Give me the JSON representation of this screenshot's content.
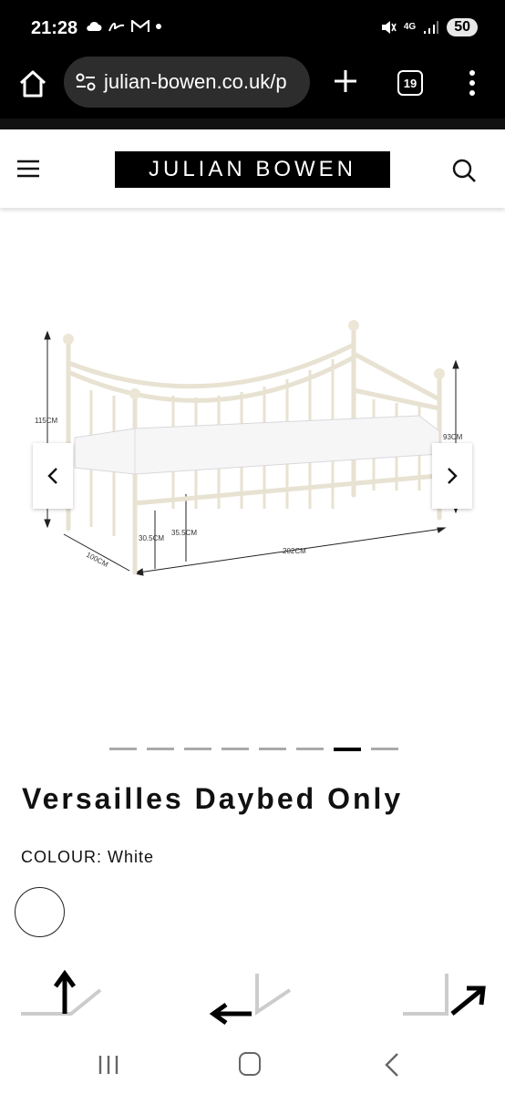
{
  "status_bar": {
    "time": "21:28",
    "network": "4G",
    "battery": "50"
  },
  "browser": {
    "url": "julian-bowen.co.uk/p",
    "tab_count": "19"
  },
  "site": {
    "logo_text": "JULIAN BOWEN"
  },
  "gallery": {
    "dimensions": {
      "height_total": "115CM",
      "height_end": "93CM",
      "width": "100CM",
      "length": "202CM",
      "clearance_low": "30.5CM",
      "clearance_high": "35.5CM"
    },
    "slide_count": 8,
    "active_slide": 7
  },
  "product": {
    "title": "Versailles Daybed Only",
    "colour_label": "COLOUR:",
    "colour_value": "White"
  }
}
